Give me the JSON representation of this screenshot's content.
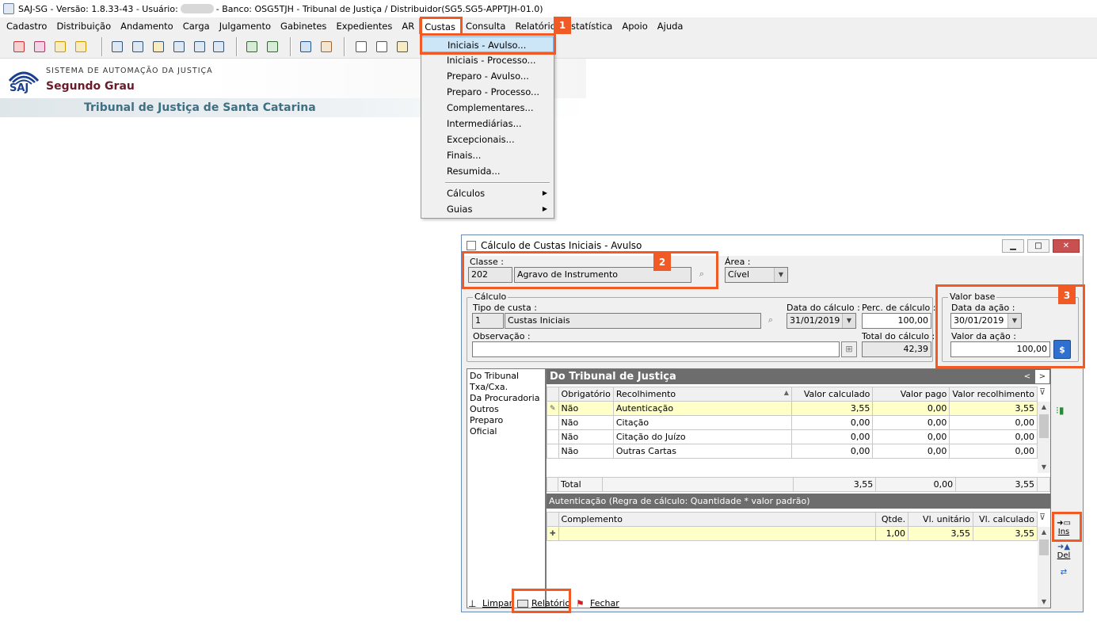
{
  "title_bar": {
    "prefix": "SAJ-SG - Versão: 1.8.33-43 - Usuário:",
    "suffix": "- Banco: OSG5TJH - Tribunal de Justiça / Distribuidor(SG5.SG5-APPTJH-01.0)"
  },
  "menu": [
    "Cadastro",
    "Distribuição",
    "Andamento",
    "Carga",
    "Julgamento",
    "Gabinetes",
    "Expedientes",
    "AR",
    "Custas",
    "Consulta",
    "Relatório",
    "Estatística",
    "Apoio",
    "Ajuda"
  ],
  "banner": {
    "system_name": "SISTEMA DE AUTOMAÇÃO DA JUSTIÇA",
    "logo_text": "SAJ",
    "grade": "Segundo Grau",
    "tribunal": "Tribunal de Justiça de Santa Catarina"
  },
  "custas_menu": {
    "items": [
      "Iniciais - Avulso...",
      "Iniciais - Processo...",
      "Preparo - Avulso...",
      "Preparo - Processo...",
      "Complementares...",
      "Intermediárias...",
      "Excepcionais...",
      "Finais...",
      "Resumida..."
    ],
    "submenus": [
      "Cálculos",
      "Guias"
    ],
    "selected": "Iniciais - Avulso..."
  },
  "badges": [
    "1",
    "2",
    "3"
  ],
  "dialog": {
    "title": "Cálculo de Custas Iniciais - Avulso",
    "classe": {
      "label": "Classe :",
      "code": "202",
      "name": "Agravo de Instrumento"
    },
    "area": {
      "label": "Área :",
      "value": "Cível"
    },
    "calculo": {
      "group": "Cálculo",
      "tipo_label": "Tipo de custa :",
      "tipo_code": "1",
      "tipo_name": "Custas Iniciais",
      "data_label": "Data do cálculo :",
      "data_value": "31/01/2019",
      "perc_label": "Perc. de cálculo :",
      "perc_value": "100,00",
      "obs_label": "Observação :",
      "obs_value": "",
      "total_label": "Total do cálculo :",
      "total_value": "42,39"
    },
    "valor_base": {
      "group": "Valor base",
      "data_label": "Data da ação :",
      "data_value": "30/01/2019",
      "valor_label": "Valor da ação :",
      "valor_value": "100,00"
    },
    "left_list": [
      "Do Tribunal",
      "Txa/Cxa.",
      "Da Procuradoria",
      "Outros",
      "Preparo",
      "Oficial"
    ],
    "panel_title": "Do Tribunal de Justiça",
    "table": {
      "columns": [
        "Obrigatório",
        "Recolhimento",
        "Valor calculado",
        "Valor pago",
        "Valor recolhimento"
      ],
      "rows": [
        [
          "Não",
          "Autenticação",
          "3,55",
          "0,00",
          "3,55"
        ],
        [
          "Não",
          "Citação",
          "0,00",
          "0,00",
          "0,00"
        ],
        [
          "Não",
          "Citação do Juízo",
          "0,00",
          "0,00",
          "0,00"
        ],
        [
          "Não",
          "Outras Cartas",
          "0,00",
          "0,00",
          "0,00"
        ]
      ],
      "total": [
        "Total",
        "3,55",
        "0,00",
        "3,55"
      ]
    },
    "regra": "Autenticação (Regra de cálculo: Quantidade * valor padrão)",
    "sub_table": {
      "columns": [
        "Complemento",
        "Qtde.",
        "Vl. unitário",
        "Vl. calculado"
      ],
      "rows": [
        [
          "",
          "1,00",
          "3,55",
          "3,55"
        ]
      ]
    },
    "side_buttons": {
      "ins": "Ins",
      "del": "Del"
    },
    "buttons": {
      "limpar": "Limpar",
      "relatorio": "Relatório",
      "fechar": "Fechar"
    }
  }
}
